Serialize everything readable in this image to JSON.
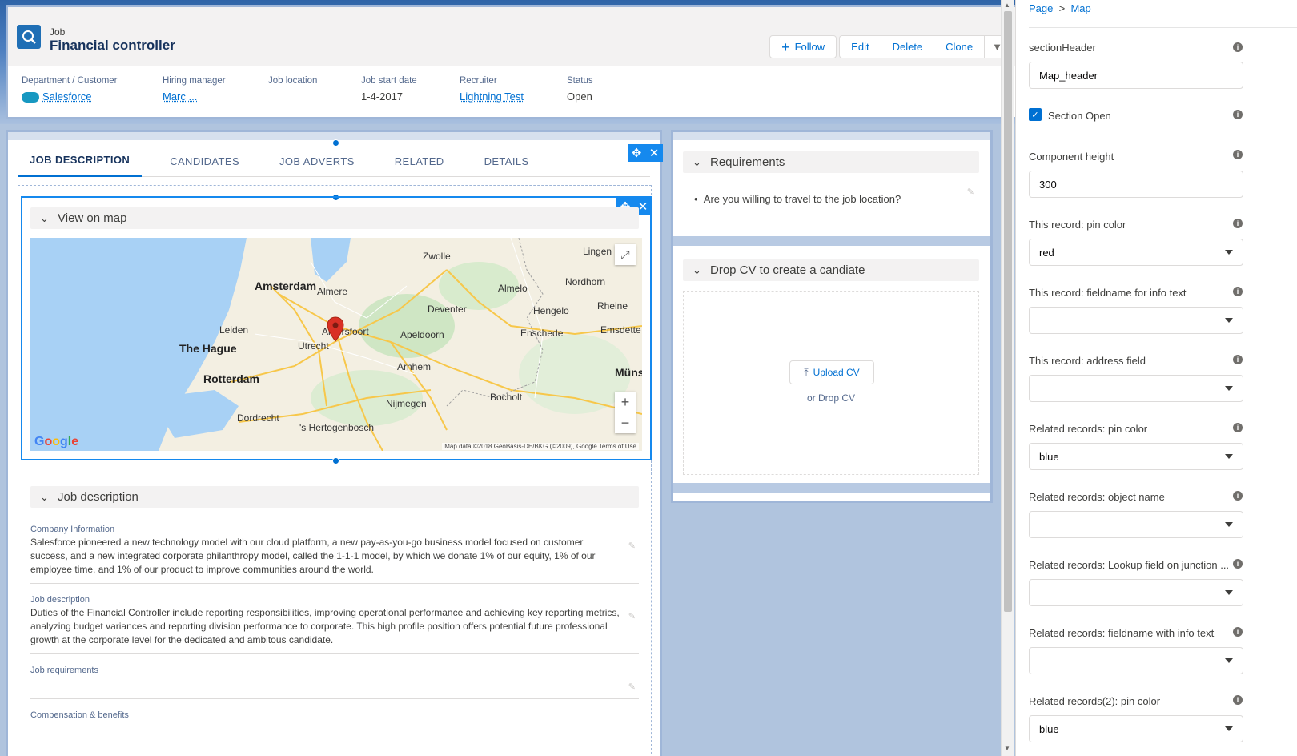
{
  "record": {
    "object_type": "Job",
    "title": "Financial controller",
    "actions": {
      "follow": "Follow",
      "edit": "Edit",
      "delete": "Delete",
      "clone": "Clone"
    },
    "fields": [
      {
        "label": "Department / Customer",
        "value": "Salesforce",
        "link": true
      },
      {
        "label": "Hiring manager",
        "value": "Marc ...",
        "link": true
      },
      {
        "label": "Job location",
        "value": "",
        "link": false
      },
      {
        "label": "Job start date",
        "value": "1-4-2017",
        "link": false
      },
      {
        "label": "Recruiter",
        "value": "Lightning Test",
        "link": true
      },
      {
        "label": "Status",
        "value": "Open",
        "link": false
      }
    ]
  },
  "tabs": [
    "JOB DESCRIPTION",
    "CANDIDATES",
    "JOB ADVERTS",
    "RELATED",
    "DETAILS"
  ],
  "map_section": {
    "header": "View on map",
    "logo": "Google",
    "attribution": "Map data ©2018 GeoBasis-DE/BKG (©2009), Google   Terms of Use",
    "places": [
      "Zwolle",
      "Lingen",
      "Amsterdam",
      "Almere",
      "Almelo",
      "Nordhorn",
      "Deventer",
      "Hengelo",
      "Rheine",
      "Leiden",
      "Amersfoort",
      "Apeldoorn",
      "Enschede",
      "Emsdette",
      "The Hague",
      "Utrecht",
      "Arnhem",
      "Rotterdam",
      "Münster",
      "Bocholt",
      "Nijmegen",
      "Dordrecht",
      "'s Hertogenbosch"
    ]
  },
  "job_description": {
    "header": "Job description",
    "fields": [
      {
        "label": "Company Information",
        "text": "Salesforce pioneered a new technology model with our cloud platform, a new pay-as-you-go business model focused on customer success, and a new integrated corporate philanthropy model, called the 1-1-1 model, by which we donate 1% of our equity, 1% of our employee time, and 1% of our product to improve communities around the world."
      },
      {
        "label": "Job description",
        "text": "Duties of the Financial Controller include reporting responsibilities, improving operational performance and achieving key reporting metrics, analyzing budget variances and reporting division performance to corporate. This high profile position offers potential future professional growth at the corporate level for the dedicated and ambitous candidate."
      },
      {
        "label": "Job requirements",
        "text": ""
      },
      {
        "label": "Compensation & benefits",
        "text": ""
      }
    ]
  },
  "requirements": {
    "header": "Requirements",
    "items": [
      "Are you willing to travel to the job location?"
    ]
  },
  "dropcv": {
    "header": "Drop CV to create a candiate",
    "upload_label": "Upload CV",
    "or_drop": "or Drop CV"
  },
  "panel": {
    "breadcrumb": {
      "page": "Page",
      "sep": ">",
      "current": "Map"
    },
    "section_header_label": "sectionHeader",
    "section_header_value": "Map_header",
    "section_open_label": "Section Open",
    "section_open_checked": true,
    "height_label": "Component height",
    "height_value": "300",
    "pin_color_label": "This record: pin color",
    "pin_color_value": "red",
    "info_field_label": "This record: fieldname for info text",
    "address_label": "This record: address field",
    "rel_pin_label": "Related records: pin color",
    "rel_pin_value": "blue",
    "rel_obj_label": "Related records: object name",
    "rel_lookup_label": "Related records: Lookup field on junction ...",
    "rel_info_label": "Related records: fieldname with info text",
    "rel2_pin_label": "Related records(2): pin color",
    "rel2_pin_value": "blue"
  },
  "colors": {
    "brand": "#0070d2",
    "pin": "#d93025",
    "builder_bg": "#b0c4de"
  }
}
